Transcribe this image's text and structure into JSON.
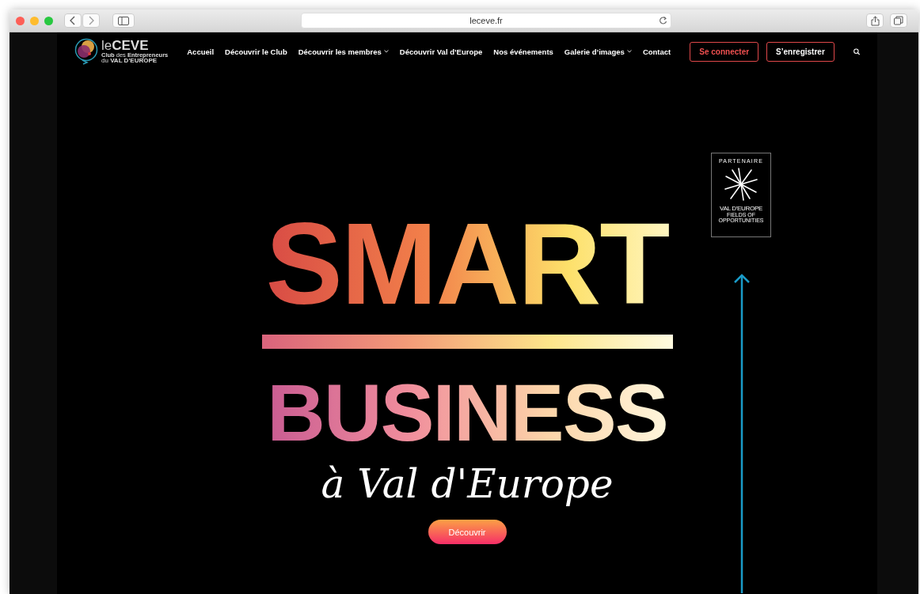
{
  "browser": {
    "url": "leceve.fr"
  },
  "logo": {
    "name_light": "le",
    "name_bold": "CEVE",
    "line1_a": "Club",
    "line1_b": "des",
    "line1_c": "Entrepreneurs",
    "line2_a": "du",
    "line2_b": "VAL D'EUROPE"
  },
  "nav": [
    {
      "label": "Accueil",
      "dropdown": false
    },
    {
      "label": "Découvrir le Club",
      "dropdown": false
    },
    {
      "label": "Découvrir les membres",
      "dropdown": true
    },
    {
      "label": "Découvrir Val d’Europe",
      "dropdown": false
    },
    {
      "label": "Nos événements",
      "dropdown": false
    },
    {
      "label": "Galerie d’images",
      "dropdown": true
    },
    {
      "label": "Contact",
      "dropdown": false
    }
  ],
  "actions": [
    {
      "label": "Se connecter",
      "kind": "accent"
    },
    {
      "label": "S’enregistrer",
      "kind": "plain"
    }
  ],
  "partner": {
    "heading": "PARTENAIRE",
    "name": "VAL D'EUROPE",
    "tagline_1": "FIELDS OF",
    "tagline_2": "OPPORTUNITIES"
  },
  "hero": {
    "title": "SMART",
    "subtitle": "BUSINESS",
    "script": "à Val d'Europe",
    "button": "Découvrir"
  }
}
